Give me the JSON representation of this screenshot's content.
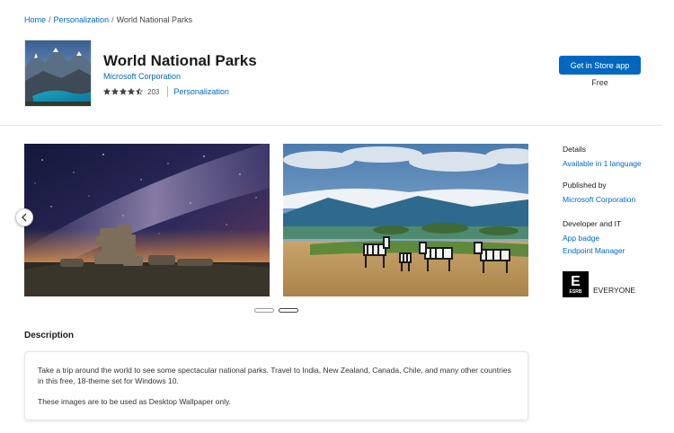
{
  "breadcrumb": {
    "home": "Home",
    "separator": "/",
    "category": "Personalization",
    "current": "World National Parks"
  },
  "app": {
    "title": "World National Parks",
    "publisher": "Microsoft Corporation",
    "rating_value": 4.5,
    "rating_count": "203",
    "category": "Personalization",
    "tile_icon": "mountain-lake-thumbnail"
  },
  "actions": {
    "get_label": "Get in Store app",
    "price": "Free"
  },
  "screenshots": {
    "items": [
      {
        "name": "milky-way-rock-screenshot"
      },
      {
        "name": "zebras-savanna-screenshot"
      }
    ],
    "active_index": 1,
    "prev_icon": "chevron-left-icon"
  },
  "details": {
    "details_heading": "Details",
    "language_link": "Available in 1 language",
    "published_by_heading": "Published by",
    "published_by_link": "Microsoft Corporation",
    "developer_heading": "Developer and IT",
    "app_badge_link": "App badge",
    "endpoint_link": "Endpoint Manager",
    "esrb_letter": "E",
    "esrb_brand": "ESRB",
    "esrb_label": "EVERYONE"
  },
  "description": {
    "heading": "Description",
    "paragraph1": "Take a trip around the world to see some spectacular national parks. Travel to India, New Zealand, Canada, Chile, and many other countries in this free, 18-theme set for Windows 10.",
    "paragraph2": "These images are to be used as Desktop Wallpaper only."
  },
  "colors": {
    "accent": "#0067c0",
    "star": "#444444"
  }
}
